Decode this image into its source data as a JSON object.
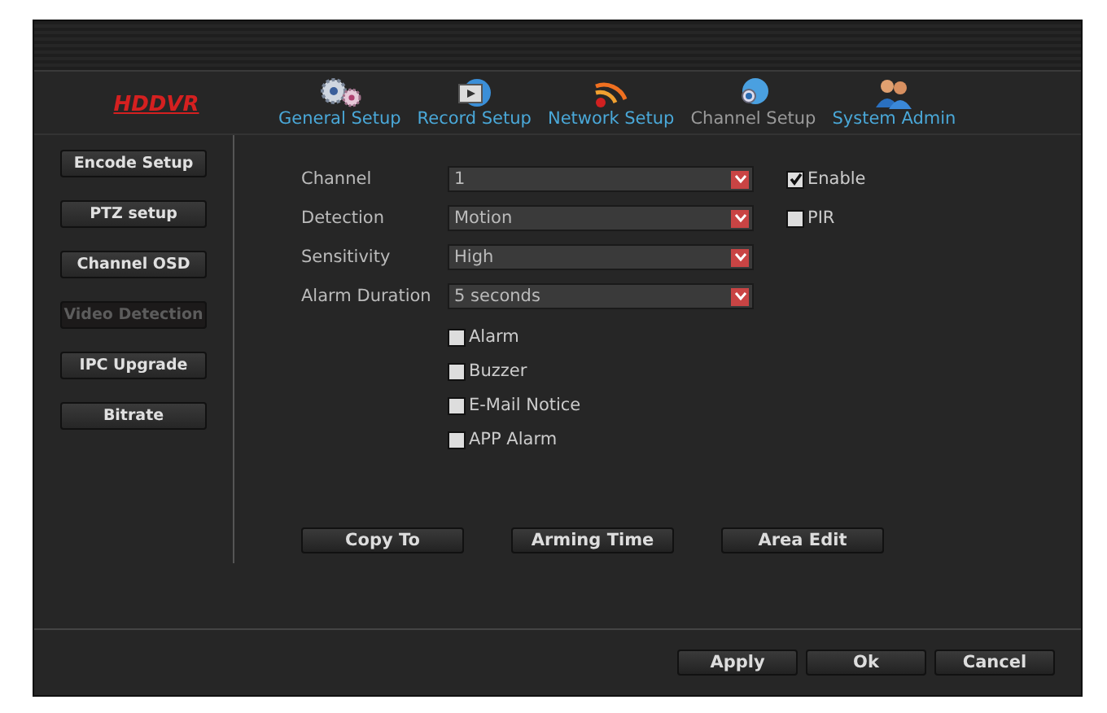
{
  "logo": "HDDVR",
  "nav": [
    {
      "label": "General Setup",
      "selected": false
    },
    {
      "label": "Record Setup",
      "selected": false
    },
    {
      "label": "Network Setup",
      "selected": false
    },
    {
      "label": "Channel Setup",
      "selected": true
    },
    {
      "label": "System Admin",
      "selected": false
    }
  ],
  "sidebar": [
    {
      "label": "Encode Setup",
      "selected": false
    },
    {
      "label": "PTZ setup",
      "selected": false
    },
    {
      "label": "Channel OSD",
      "selected": false
    },
    {
      "label": "Video Detection",
      "selected": true
    },
    {
      "label": "IPC Upgrade",
      "selected": false
    },
    {
      "label": "Bitrate",
      "selected": false
    }
  ],
  "fields": [
    {
      "label": "Channel",
      "value": "1"
    },
    {
      "label": "Detection",
      "value": "Motion"
    },
    {
      "label": "Sensitivity",
      "value": "High"
    },
    {
      "label": "Alarm Duration",
      "value": "5 seconds"
    }
  ],
  "side_options": [
    {
      "label": "Enable",
      "checked": true
    },
    {
      "label": "PIR",
      "checked": false
    }
  ],
  "actions_checks": [
    {
      "label": "Alarm",
      "checked": false
    },
    {
      "label": "Buzzer",
      "checked": false
    },
    {
      "label": "E-Mail Notice",
      "checked": false
    },
    {
      "label": "APP Alarm",
      "checked": false
    }
  ],
  "buttons": [
    "Copy To",
    "Arming Time",
    "Area Edit"
  ],
  "footer_buttons": [
    "Apply",
    "Ok",
    "Cancel"
  ]
}
